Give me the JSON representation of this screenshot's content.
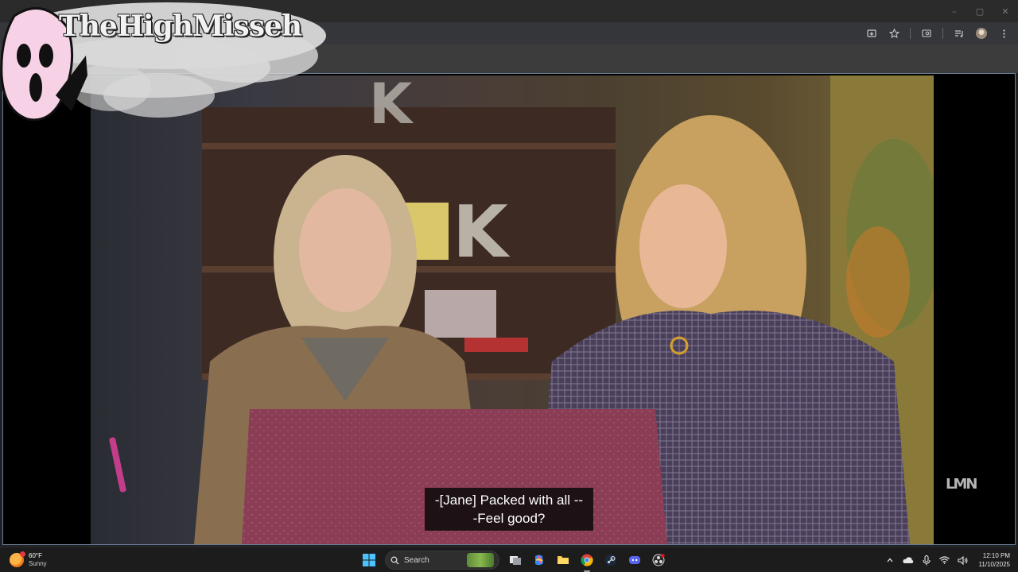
{
  "browser": {
    "window_controls": {
      "minimize": "–",
      "maximize": "▢",
      "close": "✕"
    },
    "toolbar_icons": [
      "install-app-icon",
      "bookmark-star-icon",
      "lens-icon",
      "media-controls-icon",
      "profile-avatar",
      "more-menu-icon"
    ]
  },
  "overlay": {
    "channel_name": "TheHighMisseh",
    "mascot": "ghostface-mask-icon"
  },
  "video": {
    "subtitle_line_1": "-[Jane] Packed with all --",
    "subtitle_line_2": "-Feel good?",
    "network_logo": "LMN",
    "scene_label": "two-women-at-desk-with-laptop"
  },
  "taskbar": {
    "weather": {
      "temp": "60°F",
      "condition": "Sunny",
      "icon": "partly-sunny-icon"
    },
    "search_label": "Search",
    "apps": [
      "windows-start-icon",
      "search",
      "task-view-icon",
      "copilot-icon",
      "file-explorer-icon",
      "chrome-icon",
      "steam-icon",
      "discord-icon",
      "obs-icon"
    ],
    "clock": {
      "time": "12:10 PM",
      "date": "11/10/2025"
    }
  },
  "colors": {
    "chrome_titlebar": "#2b2b2b",
    "chrome_toolbar": "#35363a",
    "taskbar": "#1c1c1c",
    "video_border": "#6a7d95",
    "subtitle_bg": "#0a0a0a"
  }
}
